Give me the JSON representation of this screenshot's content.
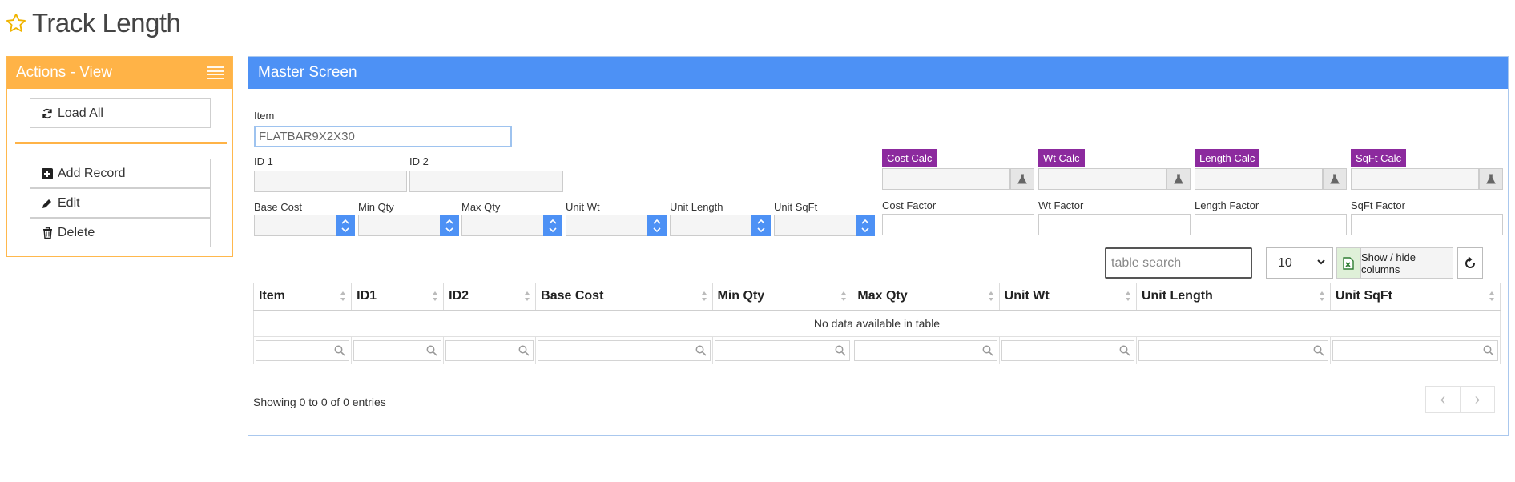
{
  "page": {
    "title": "Track Length"
  },
  "actions": {
    "title": "Actions - View",
    "load_all": "Load All",
    "add_record": "Add Record",
    "edit": "Edit",
    "delete": "Delete"
  },
  "master": {
    "title": "Master Screen",
    "item_label": "Item",
    "item_value": "FLATBAR9X2X30",
    "id1_label": "ID 1",
    "id2_label": "ID 2",
    "base_cost_label": "Base Cost",
    "min_qty_label": "Min Qty",
    "max_qty_label": "Max Qty",
    "unit_wt_label": "Unit Wt",
    "unit_length_label": "Unit Length",
    "unit_sqft_label": "Unit SqFt",
    "cost_calc": "Cost Calc",
    "wt_calc": "Wt Calc",
    "length_calc": "Length Calc",
    "sqft_calc": "SqFt Calc",
    "cost_factor_label": "Cost Factor",
    "wt_factor_label": "Wt Factor",
    "length_factor_label": "Length Factor",
    "sqft_factor_label": "SqFt Factor"
  },
  "table": {
    "search_placeholder": "table search",
    "page_length": "10",
    "show_hide_columns": "Show / hide columns",
    "columns": [
      "Item",
      "ID1",
      "ID2",
      "Base Cost",
      "Min Qty",
      "Max Qty",
      "Unit Wt",
      "Unit Length",
      "Unit SqFt"
    ],
    "empty_message": "No data available in table",
    "info": "Showing 0 to 0 of 0 entries",
    "prev_label": "‹",
    "next_label": "›"
  },
  "colors": {
    "actions_header": "#ffb347",
    "master_header": "#4d91f5",
    "calc_badge": "#8c2a9e"
  }
}
